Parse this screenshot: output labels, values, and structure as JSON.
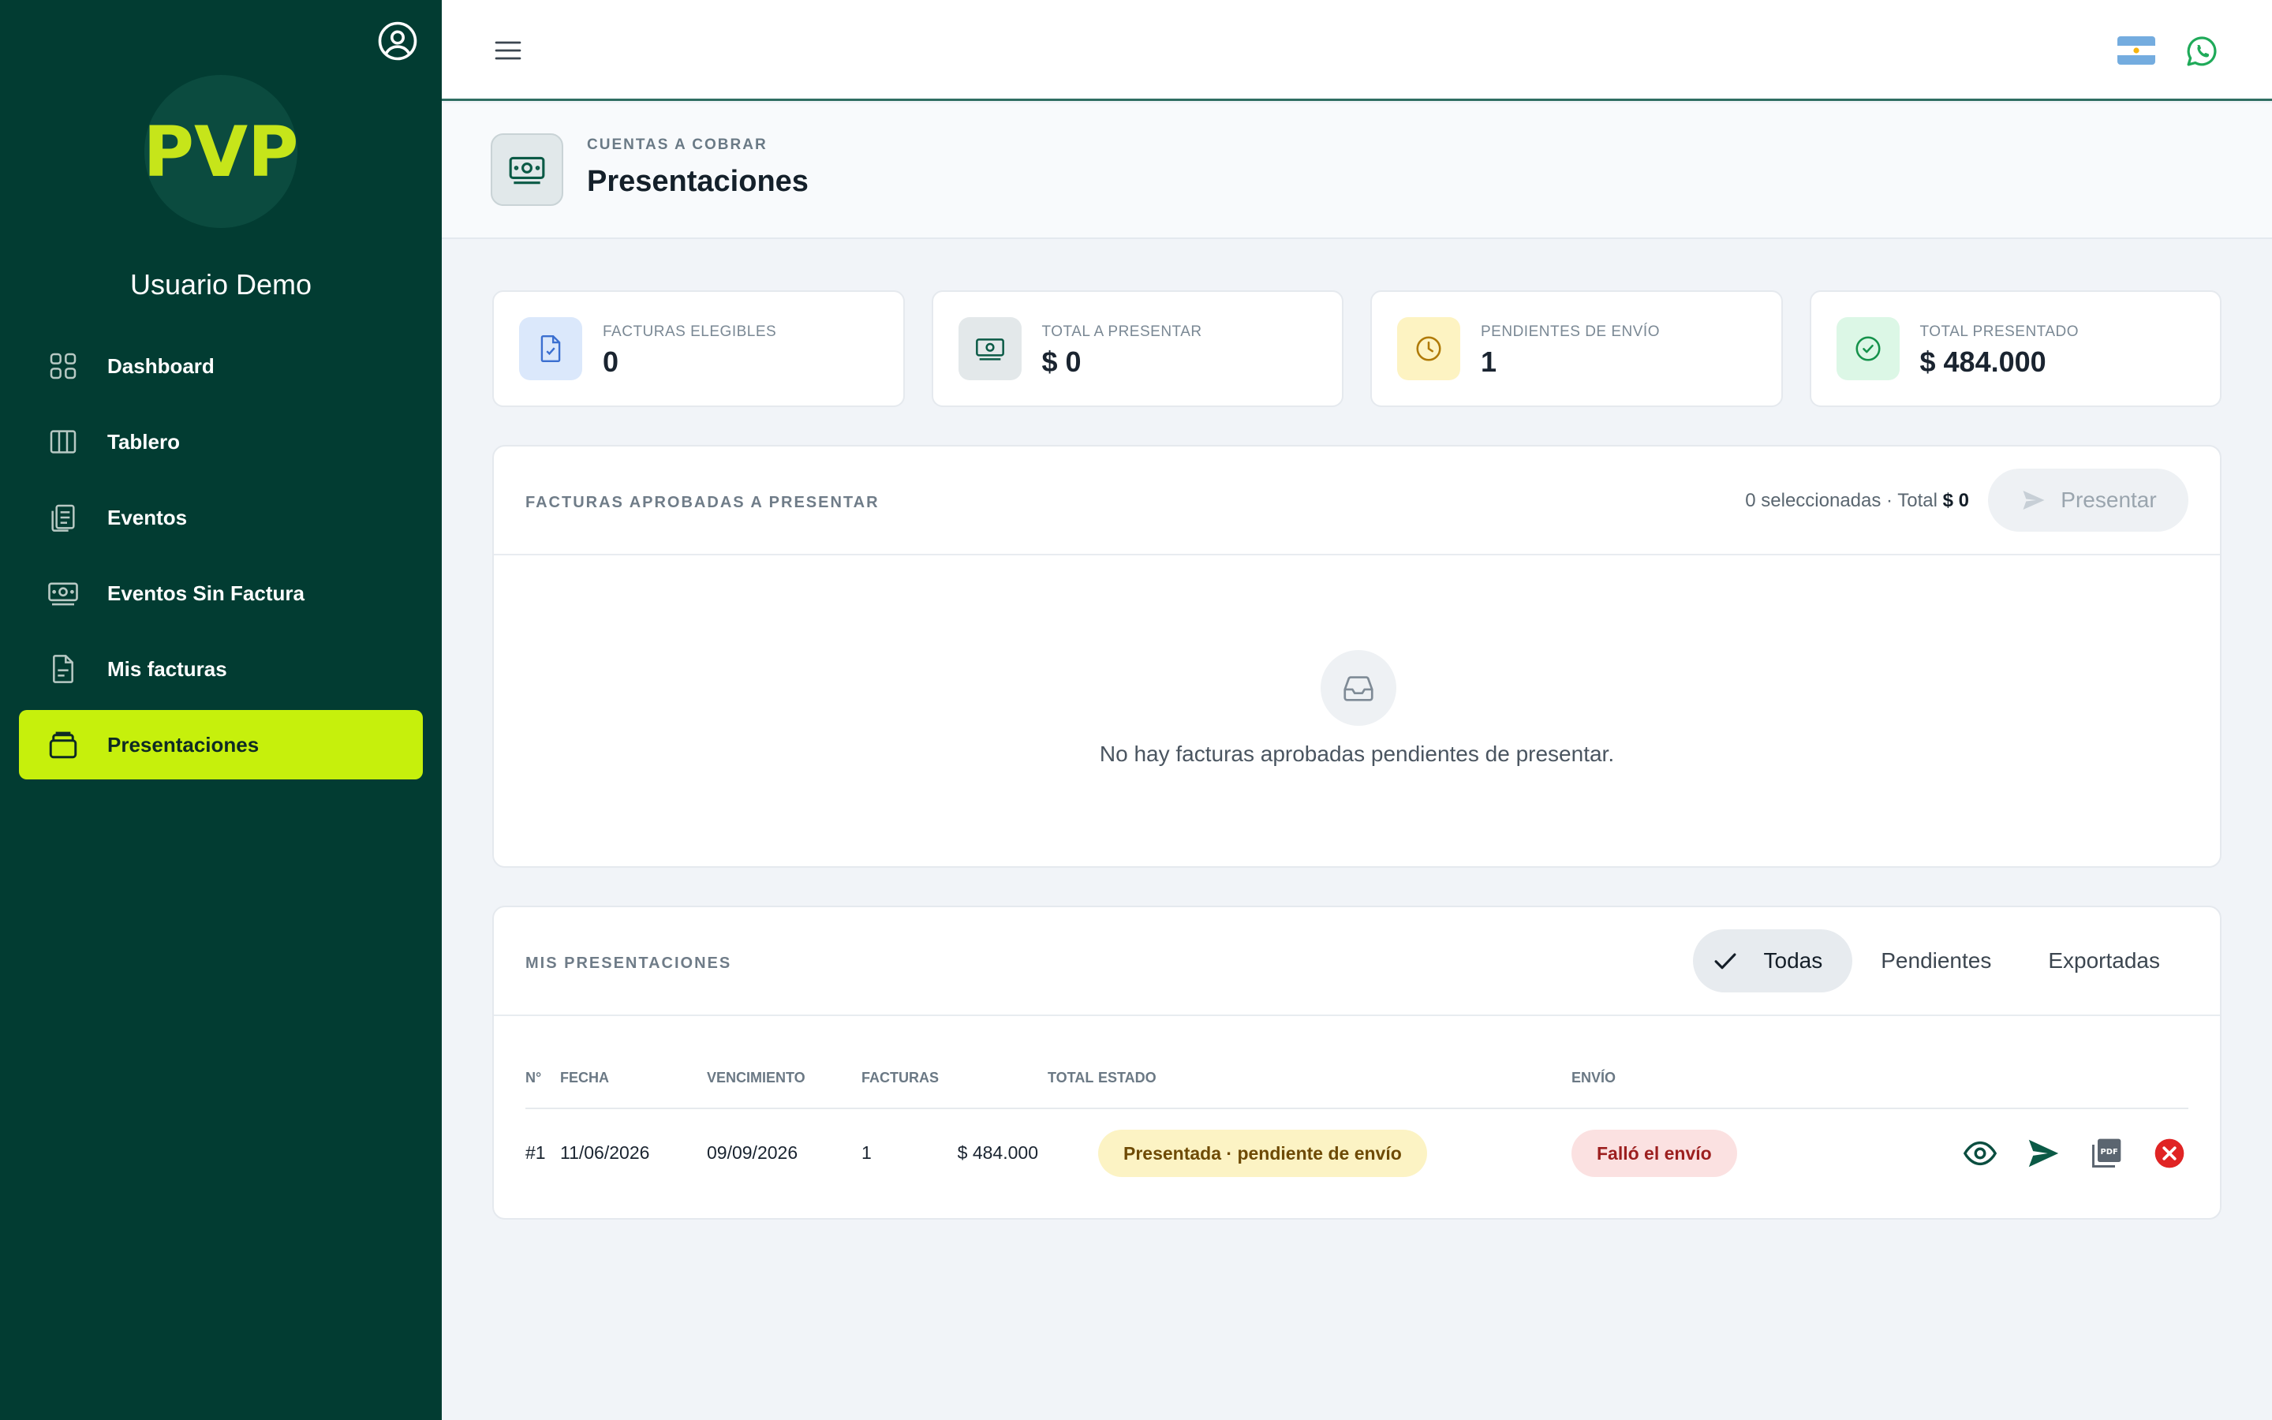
{
  "sidebar": {
    "logo_text": "PVP",
    "user_name": "Usuario Demo",
    "items": [
      {
        "label": "Dashboard",
        "icon": "grid-icon"
      },
      {
        "label": "Tablero",
        "icon": "columns-icon"
      },
      {
        "label": "Eventos",
        "icon": "clipboard-list-icon"
      },
      {
        "label": "Eventos Sin Factura",
        "icon": "cash-icon"
      },
      {
        "label": "Mis facturas",
        "icon": "document-icon"
      },
      {
        "label": "Presentaciones",
        "icon": "stack-icon",
        "active": true
      }
    ]
  },
  "topbar": {
    "menu_icon": "hamburger-icon",
    "flag_icon": "argentina-flag-icon",
    "whatsapp_icon": "whatsapp-icon"
  },
  "header": {
    "eyebrow": "CUENTAS A COBRAR",
    "title": "Presentaciones"
  },
  "stats": [
    {
      "label": "FACTURAS ELEGIBLES",
      "value": "0",
      "icon": "document-check-icon",
      "color": "#dbe8fb"
    },
    {
      "label": "TOTAL A PRESENTAR",
      "value": "$ 0",
      "icon": "cash-icon",
      "color": "#e3e8ea"
    },
    {
      "label": "PENDIENTES DE ENVÍO",
      "value": "1",
      "icon": "clock-icon",
      "color": "#fdf3c2"
    },
    {
      "label": "TOTAL PRESENTADO",
      "value": "$ 484.000",
      "icon": "check-circle-icon",
      "color": "#dcf7e6"
    }
  ],
  "approved": {
    "title": "FACTURAS APROBADAS A PRESENTAR",
    "selected": "0 seleccionadas · Total",
    "selected_total": "$ 0",
    "present_button": "Presentar",
    "empty_text": "No hay facturas aprobadas pendientes de presentar."
  },
  "mine": {
    "title": "MIS PRESENTACIONES",
    "tabs": [
      {
        "label": "Todas",
        "active": true
      },
      {
        "label": "Pendientes"
      },
      {
        "label": "Exportadas"
      }
    ],
    "columns": [
      "N°",
      "FECHA",
      "VENCIMIENTO",
      "FACTURAS",
      "TOTAL",
      "ESTADO",
      "ENVÍO"
    ],
    "rows": [
      {
        "num": "#1",
        "fecha": "11/06/2026",
        "vencimiento": "09/09/2026",
        "facturas": "1",
        "total": "$ 484.000",
        "estado": "Presentada · pendiente de envío",
        "envio": "Falló el envío"
      }
    ]
  },
  "colors": {
    "sidebar": "#023c32",
    "accent": "#c6f00c",
    "primary": "#0b5a46",
    "danger": "#e02424"
  }
}
